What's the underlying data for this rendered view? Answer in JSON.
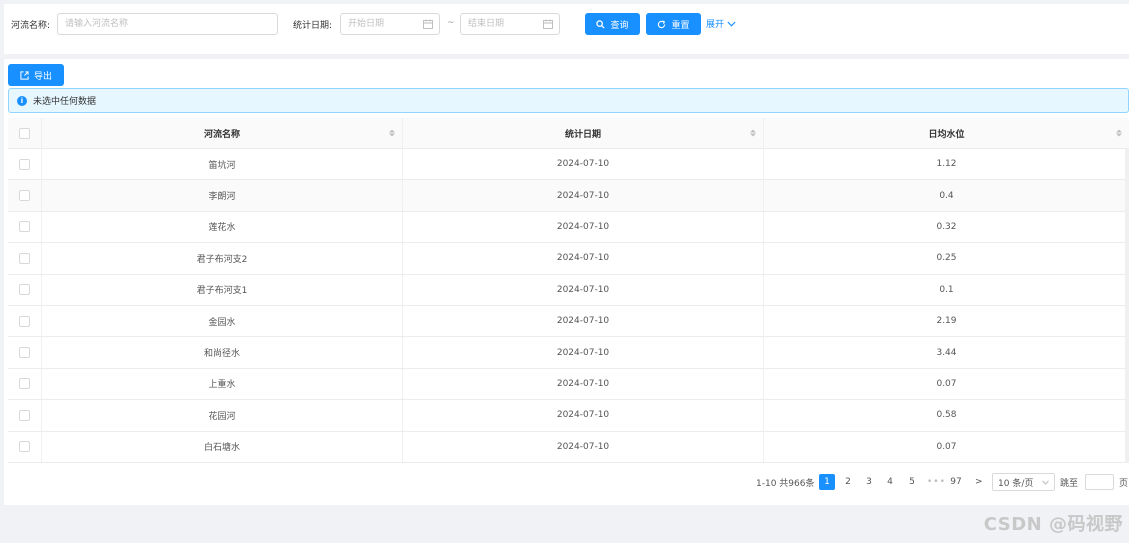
{
  "search": {
    "river_label": "河流名称:",
    "river_placeholder": "请输入河流名称",
    "date_label": "统计日期:",
    "start_placeholder": "开始日期",
    "separator": "~",
    "end_placeholder": "结束日期",
    "query_label": "查询",
    "reset_label": "重置",
    "expand_label": "展开"
  },
  "toolbar": {
    "export_label": "导出"
  },
  "alert": {
    "text": "未选中任何数据"
  },
  "table": {
    "columns": [
      "河流名称",
      "统计日期",
      "日均水位"
    ],
    "rows": [
      [
        "笛坑河",
        "2024-07-10",
        "1.12"
      ],
      [
        "李朗河",
        "2024-07-10",
        "0.4"
      ],
      [
        "莲花水",
        "2024-07-10",
        "0.32"
      ],
      [
        "君子布河支2",
        "2024-07-10",
        "0.25"
      ],
      [
        "君子布河支1",
        "2024-07-10",
        "0.1"
      ],
      [
        "金园水",
        "2024-07-10",
        "2.19"
      ],
      [
        "和尚径水",
        "2024-07-10",
        "3.44"
      ],
      [
        "上重水",
        "2024-07-10",
        "0.07"
      ],
      [
        "花园河",
        "2024-07-10",
        "0.58"
      ],
      [
        "白石塘水",
        "2024-07-10",
        "0.07"
      ]
    ]
  },
  "pagination": {
    "total_text": "1-10 共966条",
    "pages": [
      "1",
      "2",
      "3",
      "4",
      "5"
    ],
    "ellipsis": "•••",
    "last_page": "97",
    "next": ">",
    "page_size": "10 条/页",
    "jump_label": "跳至",
    "page_unit": "页"
  },
  "watermark": "CSDN @码视野",
  "colors": {
    "primary": "#1890ff",
    "alert_bg": "#e6f7ff",
    "alert_border": "#91d5ff"
  }
}
